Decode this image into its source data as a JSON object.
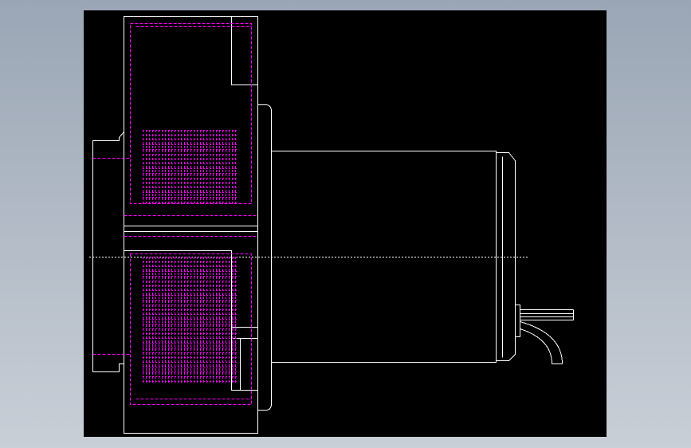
{
  "viewport": {
    "background_top": "#9aa6b5",
    "background_bottom": "#c9cfd7"
  },
  "drawing": {
    "sheet_color": "#000000",
    "line_color": "#ffffff",
    "hidden_line_color": "#ff00ff",
    "centerline_color": "#ffffff"
  }
}
